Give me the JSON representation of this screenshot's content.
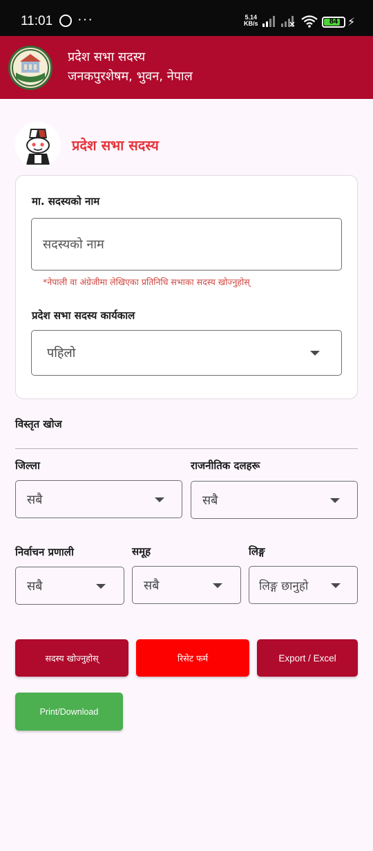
{
  "status_bar": {
    "time": "11:01",
    "speed_value": "5.14",
    "speed_unit": "KB/s",
    "battery": "84"
  },
  "appbar": {
    "title": "प्रदेश सभा सदस्य",
    "subtitle": "जनकपुरशेषम, भुवन, नेपाल"
  },
  "section": {
    "title": "प्रदेश सभा सदस्य"
  },
  "form": {
    "name_label": "मा. सदस्यको नाम",
    "name_placeholder": "सदस्यको नाम",
    "name_hint": "*नेपाली वा अंग्रेजीमा लेखिएका प्रतिनिधि सभाका सदस्य खोज्नुहोस्",
    "term_label": "प्रदेश सभा सदस्य कार्यकाल",
    "term_value": "पहिलो"
  },
  "advanced": {
    "heading": "विस्तृत खोज",
    "district_label": "जिल्ला",
    "district_value": "सबै",
    "party_label": "राजनीतिक दलहरू",
    "party_value": "सबै",
    "election_label": "निर्वाचन प्रणाली",
    "election_value": "सबै",
    "group_label": "समूह",
    "group_value": "सबै",
    "gender_label": "लिङ्ग",
    "gender_value": "लिङ्ग छानुहो"
  },
  "buttons": {
    "search": "सदस्य खोज्नुहोस्",
    "reset": "रिसेट फर्म",
    "export": "Export / Excel",
    "print": "Print/Download"
  },
  "colors": {
    "brand": "#b00a2c",
    "reset": "#fd0000",
    "print": "#4caf50",
    "accent_text": "#e5343b"
  }
}
